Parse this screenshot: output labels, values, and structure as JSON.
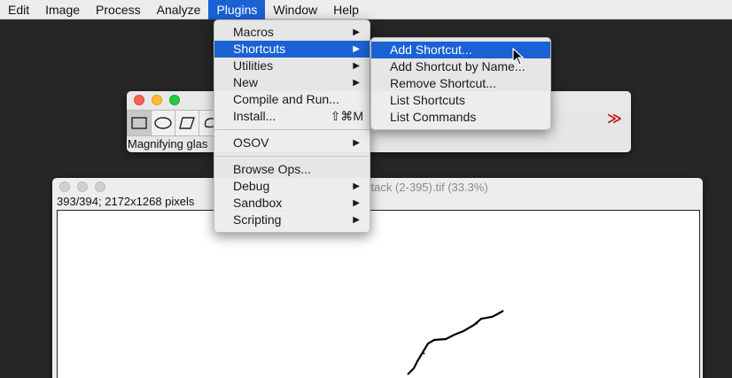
{
  "menubar": {
    "items": [
      "Edit",
      "Image",
      "Process",
      "Analyze",
      "Plugins",
      "Window",
      "Help"
    ],
    "active": "Plugins"
  },
  "toolbar_window": {
    "status": "Magnifying glas",
    "tool_icons": [
      "rectangle-tool-icon",
      "oval-tool-icon",
      "polygon-tool-icon",
      "freehand-tool-icon"
    ],
    "more_tools_label": "≫"
  },
  "image_window": {
    "title": "stack (2-395).tif (33.3%)",
    "info": "393/394; 2172x1268 pixels"
  },
  "plugins_menu": {
    "items": [
      {
        "label": "Macros",
        "submenu": true
      },
      {
        "label": "Shortcuts",
        "submenu": true,
        "highlighted": true
      },
      {
        "label": "Utilities",
        "submenu": true
      },
      {
        "label": "New",
        "submenu": true
      },
      {
        "label": "Compile and Run..."
      },
      {
        "label": "Install...",
        "shortcut": "⇧⌘M"
      },
      {
        "separator": true
      },
      {
        "label": "OSOV",
        "submenu": true
      },
      {
        "separator": true
      },
      {
        "label": "Browse Ops..."
      },
      {
        "label": "Debug",
        "submenu": true
      },
      {
        "label": "Sandbox",
        "submenu": true
      },
      {
        "label": "Scripting",
        "submenu": true
      }
    ]
  },
  "shortcuts_menu": {
    "items": [
      {
        "label": "Add Shortcut...",
        "highlighted": true
      },
      {
        "label": "Add Shortcut by Name..."
      },
      {
        "label": "Remove Shortcut..."
      },
      {
        "label": "List Shortcuts"
      },
      {
        "label": "List Commands"
      }
    ]
  },
  "colors": {
    "accent": "#1a62d4",
    "desktop": "#262626"
  }
}
